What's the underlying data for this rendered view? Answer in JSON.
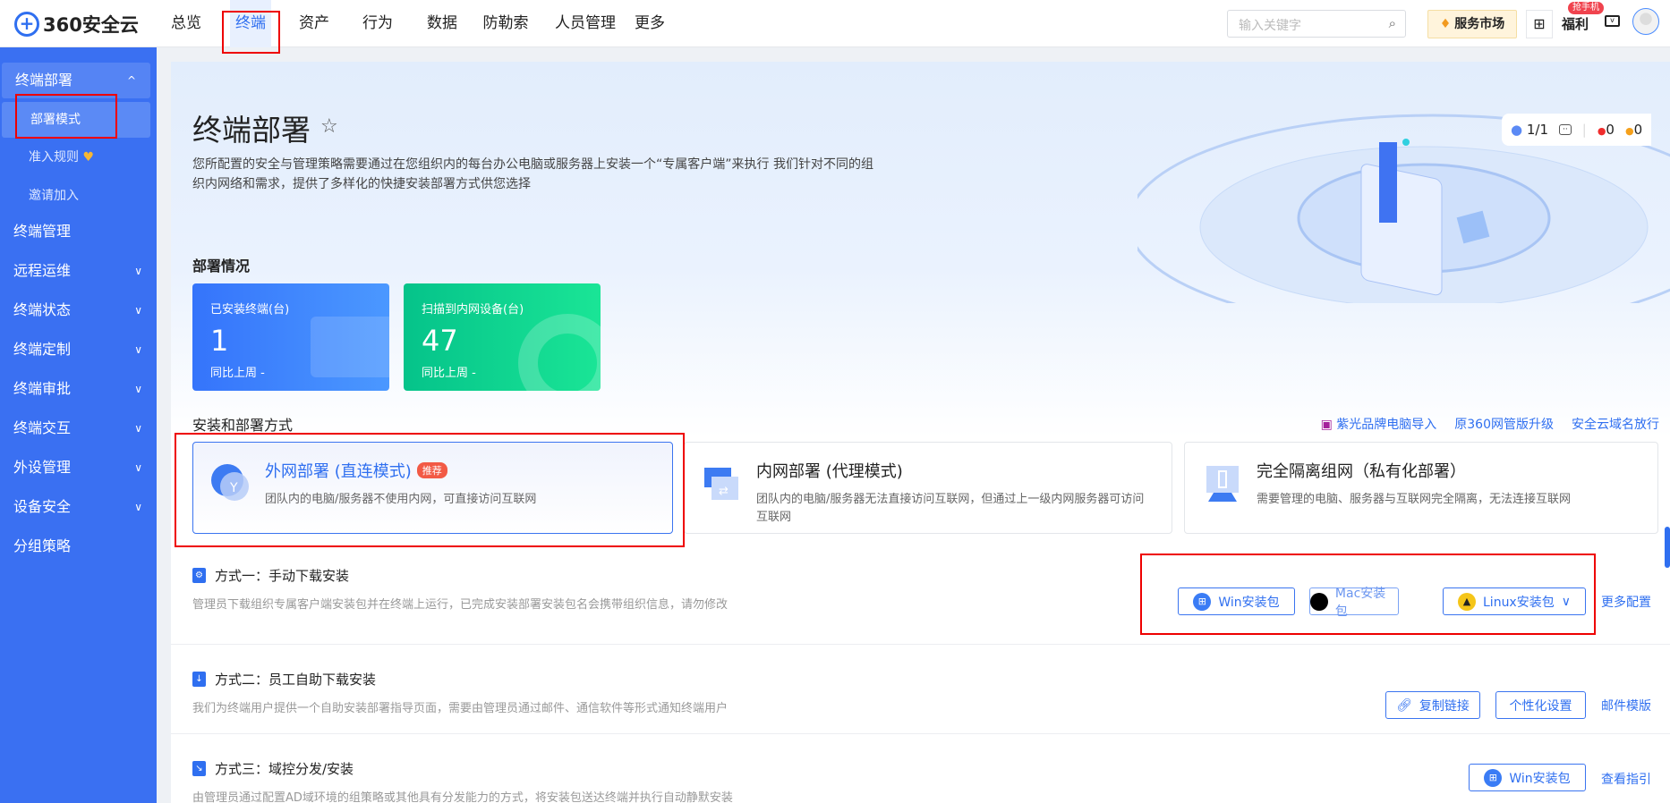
{
  "app": {
    "logo": "360安全云"
  },
  "nav": [
    "总览",
    "终端",
    "资产",
    "行为",
    "数据",
    "防勒索",
    "人员管理",
    "更多"
  ],
  "header": {
    "search_placeholder": "输入关键字",
    "market": "服务市场",
    "welfare": "福利",
    "welfare_badge": "抢手机"
  },
  "sidebar": {
    "items": [
      {
        "label": "终端部署",
        "chev": "^"
      },
      {
        "label": "部署模式"
      },
      {
        "label": "准入规则"
      },
      {
        "label": "邀请加入"
      },
      {
        "label": "终端管理"
      },
      {
        "label": "远程运维",
        "chev": "∨"
      },
      {
        "label": "终端状态",
        "chev": "∨"
      },
      {
        "label": "终端定制",
        "chev": "∨"
      },
      {
        "label": "终端审批",
        "chev": "∨"
      },
      {
        "label": "终端交互",
        "chev": "∨"
      },
      {
        "label": "外设管理",
        "chev": "∨"
      },
      {
        "label": "设备安全",
        "chev": "∨"
      },
      {
        "label": "分组策略"
      }
    ]
  },
  "page": {
    "title": "终端部署",
    "desc": "您所配置的安全与管理策略需要通过在您组织内的每台办公电脑或服务器上安装一个“专属客户端”来执行 我们针对不同的组织内网络和需求，提供了多样化的快捷安装部署方式供您选择",
    "stats": {
      "progress": "1/1",
      "red": "0",
      "orange": "0"
    }
  },
  "status": {
    "heading": "部署情况",
    "cards": [
      {
        "label": "已安装终端(台)",
        "value": "1",
        "foot": "同比上周 -"
      },
      {
        "label": "扫描到内网设备(台)",
        "value": "47",
        "foot": "同比上周 -"
      }
    ]
  },
  "methods": {
    "heading": "安装和部署方式",
    "links": [
      "紫光品牌电脑导入",
      "原360网管版升级",
      "安全云域名放行"
    ],
    "modes": [
      {
        "title": "外网部署 (直连模式)",
        "tag": "推荐",
        "desc": "团队内的电脑/服务器不使用内网，可直接访问互联网"
      },
      {
        "title": "内网部署 (代理模式)",
        "desc": "团队内的电脑/服务器无法直接访问互联网，但通过上一级内网服务器可访问互联网"
      },
      {
        "title": "完全隔离组网（私有化部署）",
        "desc": "需要管理的电脑、服务器与互联网完全隔离，无法连接互联网"
      }
    ]
  },
  "ways": [
    {
      "title": "方式一：手动下载安装",
      "desc": "管理员下载组织专属客户端安装包并在终端上运行，已完成安装部署安装包名会携带组织信息，请勿修改",
      "buttons": [
        "Win安装包",
        "Mac安装包",
        "Linux安装包"
      ],
      "link": "更多配置"
    },
    {
      "title": "方式二：员工自助下载安装",
      "desc": "我们为终端用户提供一个自助安装部署指导页面，需要由管理员通过邮件、通信软件等形式通知终端用户",
      "buttons": [
        "复制链接",
        "个性化设置"
      ],
      "link": "邮件模版"
    },
    {
      "title": "方式三：域控分发/安装",
      "desc": "由管理员通过配置AD域环境的组策略或其他具有分发能力的方式，将安装包送达终端并执行自动静默安装",
      "buttons": [
        "Win安装包"
      ],
      "link": "查看指引"
    }
  ]
}
